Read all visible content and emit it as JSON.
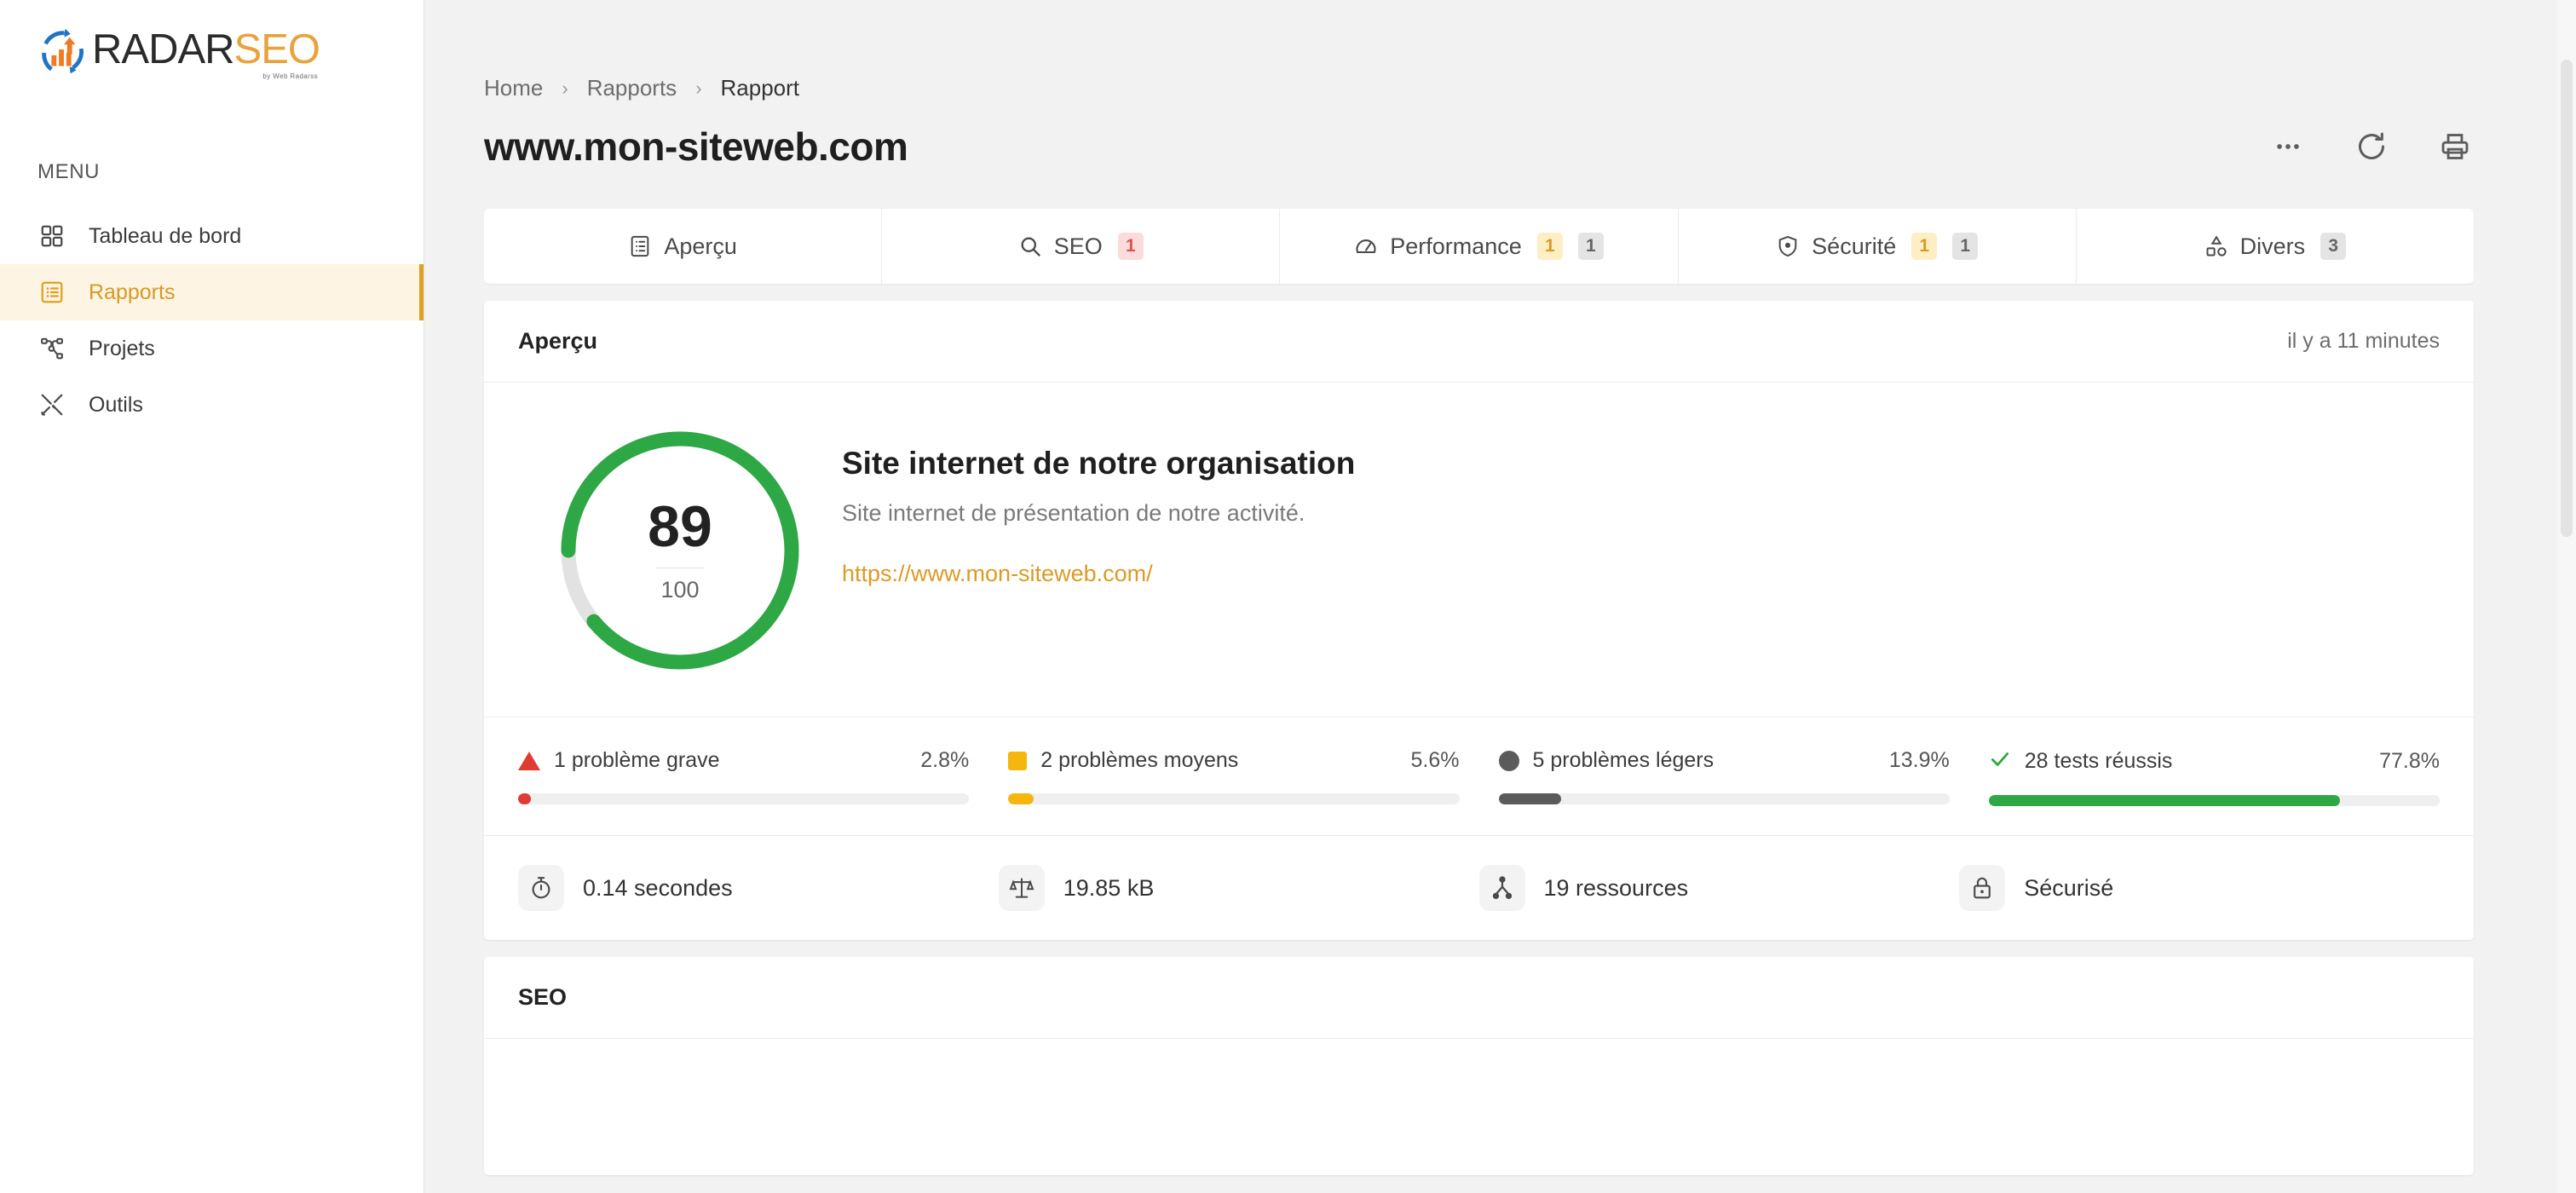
{
  "sidebar": {
    "logo": {
      "word1": "RADAR",
      "word2": "SEO",
      "tagline": "by Web Radarss",
      "icon": "radar-chart-icon"
    },
    "menu_label": "MENU",
    "items": [
      {
        "label": "Tableau de bord",
        "icon": "grid-icon",
        "active": false
      },
      {
        "label": "Rapports",
        "icon": "list-box-icon",
        "active": true
      },
      {
        "label": "Projets",
        "icon": "sitemap-icon",
        "active": false
      },
      {
        "label": "Outils",
        "icon": "tools-icon",
        "active": false
      }
    ]
  },
  "breadcrumb": {
    "items": [
      "Home",
      "Rapports",
      "Rapport"
    ],
    "separator": "›"
  },
  "header": {
    "title": "www.mon-siteweb.com",
    "actions": [
      {
        "name": "more-options-button",
        "icon": "ellipsis-icon"
      },
      {
        "name": "refresh-button",
        "icon": "refresh-icon"
      },
      {
        "name": "print-button",
        "icon": "printer-icon"
      }
    ]
  },
  "tabs": [
    {
      "label": "Aperçu",
      "icon": "list-box-icon",
      "badges": [],
      "active": true
    },
    {
      "label": "SEO",
      "icon": "search-icon",
      "badges": [
        {
          "value": "1",
          "color": "red"
        }
      ],
      "active": false
    },
    {
      "label": "Performance",
      "icon": "gauge-icon",
      "badges": [
        {
          "value": "1",
          "color": "yellow"
        },
        {
          "value": "1",
          "color": "gray"
        }
      ],
      "active": false
    },
    {
      "label": "Sécurité",
      "icon": "shield-icon",
      "badges": [
        {
          "value": "1",
          "color": "yellow"
        },
        {
          "value": "1",
          "color": "gray"
        }
      ],
      "active": false
    },
    {
      "label": "Divers",
      "icon": "shapes-icon",
      "badges": [
        {
          "value": "3",
          "color": "gray"
        }
      ],
      "active": false
    }
  ],
  "overview": {
    "card_title": "Aperçu",
    "timestamp": "il y a 11 minutes",
    "score": {
      "value": "89",
      "total": "100",
      "percent": 89,
      "color": "#2ea745",
      "track_color": "#e2e2e2"
    },
    "site": {
      "title": "Site internet de notre organisation",
      "description": "Site internet de présentation de notre activité.",
      "url": "https://www.mon-siteweb.com/"
    },
    "stats": [
      {
        "label": "1 problème grave",
        "percent_label": "2.8%",
        "percent": 2.8,
        "color": "#e03b32",
        "marker": "triangle"
      },
      {
        "label": "2 problèmes moyens",
        "percent_label": "5.6%",
        "percent": 5.6,
        "color": "#f5b60d",
        "marker": "square"
      },
      {
        "label": "5 problèmes légers",
        "percent_label": "13.9%",
        "percent": 13.9,
        "color": "#5b5b5b",
        "marker": "circle"
      },
      {
        "label": "28 tests réussis",
        "percent_label": "77.8%",
        "percent": 77.8,
        "color": "#2ea745",
        "marker": "check"
      }
    ],
    "metrics": [
      {
        "value": "0.14 secondes",
        "icon": "stopwatch-icon"
      },
      {
        "value": "19.85 kB",
        "icon": "scales-icon"
      },
      {
        "value": "19 ressources",
        "icon": "sitemap-icon"
      },
      {
        "value": "Sécurisé",
        "icon": "lock-icon"
      }
    ]
  },
  "seo_section": {
    "card_title": "SEO"
  },
  "colors": {
    "accent": "#e0a020",
    "accent_bg": "#fdf4e3",
    "link": "#dd9a24",
    "page_bg": "#f2f2f2"
  }
}
